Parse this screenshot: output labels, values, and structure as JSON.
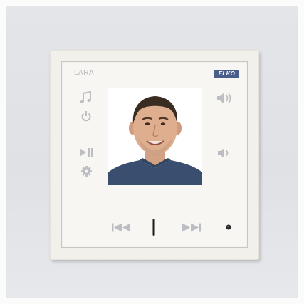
{
  "device": {
    "model_label": "LARA",
    "brand_label": "ELKO",
    "display": {
      "content": "video-call-portrait"
    }
  },
  "controls": {
    "left": [
      "music-note-icon",
      "power-icon",
      "play-pause-icon",
      "settings-icon"
    ],
    "right": [
      "volume-up-icon",
      "volume-down-icon"
    ],
    "bottom": [
      "previous-track-icon",
      "status-led",
      "next-track-icon",
      "ir-sensor-dot"
    ]
  },
  "colors": {
    "icon": "#bdbec3",
    "led": "#1a1a1a",
    "brand_badge": "#4a5e8c"
  }
}
